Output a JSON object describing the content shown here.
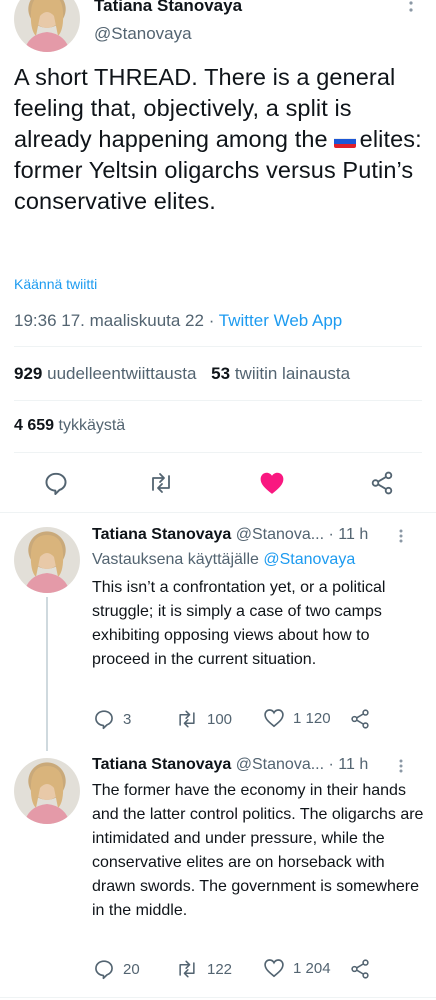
{
  "main": {
    "author_name": "Tatiana Stanovaya",
    "author_handle": "@Stanovaya",
    "text_before_flag": "A short THREAD. There is a general feeling that, objectively, a split is already happening among the",
    "text_after_flag": "elites: former Yeltsin oligarchs versus Putin’s conservative elites.",
    "translate_label": "Käännä twiitti",
    "timestamp": "19:36 17. maaliskuuta 22",
    "dot": "·",
    "source": "Twitter Web App",
    "retweets_count": "929",
    "retweets_label": "uudelleentwiittausta",
    "quotes_count": "53",
    "quotes_label": "twiitin lainausta",
    "likes_count": "4 659",
    "likes_label": "tykkäystä"
  },
  "colors": {
    "like_active": "#f91880",
    "link": "#1d9bf0",
    "muted": "#536471"
  },
  "replies": [
    {
      "author_name": "Tatiana Stanovaya",
      "author_handle": "@Stanova...",
      "time": "· 11 h",
      "replying_to_prefix": "Vastauksena käyttäjälle",
      "replying_to_handle": "@Stanovaya",
      "text": "This isn’t a confrontation yet, or a political struggle; it is simply a case of two camps exhibiting opposing views about how to proceed in the current situation.",
      "replies": "3",
      "retweets": "100",
      "likes": "1 120"
    },
    {
      "author_name": "Tatiana Stanovaya",
      "author_handle": "@Stanova...",
      "time": "· 11 h",
      "text": "The former have the economy in their hands and the latter control politics. The oligarchs are intimidated and under pressure, while the conservative elites are on horseback with drawn swords. The government is somewhere in the middle.",
      "replies": "20",
      "retweets": "122",
      "likes": "1 204"
    }
  ]
}
